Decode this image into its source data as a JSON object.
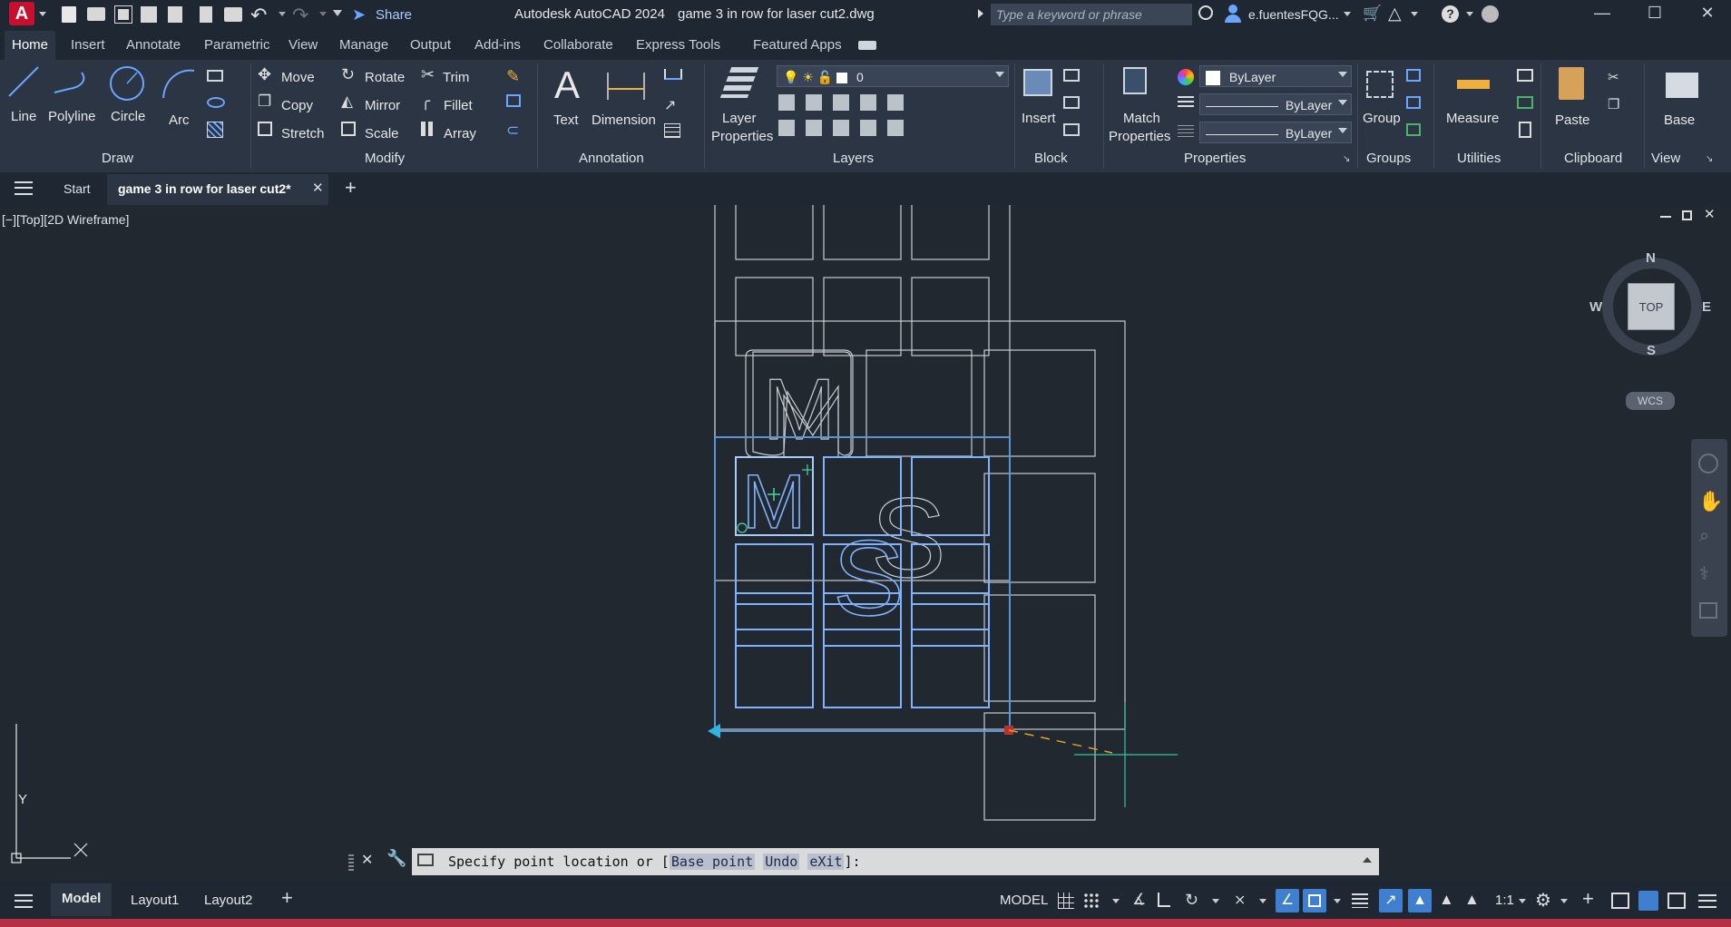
{
  "titlebar": {
    "app_title": "Autodesk AutoCAD 2024",
    "file_name": "game 3 in row for laser cut2.dwg",
    "share_label": "Share",
    "search_placeholder": "Type a keyword or phrase",
    "user_name": "e.fuentesFQG..."
  },
  "ribbon_tabs": [
    "Home",
    "Insert",
    "Annotate",
    "Parametric",
    "View",
    "Manage",
    "Output",
    "Add-ins",
    "Collaborate",
    "Express Tools",
    "Featured Apps"
  ],
  "draw": {
    "title": "Draw",
    "line": "Line",
    "polyline": "Polyline",
    "circle": "Circle",
    "arc": "Arc"
  },
  "modify": {
    "title": "Modify",
    "move": "Move",
    "rotate": "Rotate",
    "trim": "Trim",
    "copy": "Copy",
    "mirror": "Mirror",
    "fillet": "Fillet",
    "stretch": "Stretch",
    "scale": "Scale",
    "array": "Array"
  },
  "annotation": {
    "title": "Annotation",
    "text": "Text",
    "dimension": "Dimension"
  },
  "layers": {
    "title": "Layers",
    "layer_properties_1": "Layer",
    "layer_properties_2": "Properties",
    "current_layer": "0"
  },
  "block": {
    "title": "Block",
    "insert": "Insert"
  },
  "properties": {
    "title": "Properties",
    "match_1": "Match",
    "match_2": "Properties",
    "color": "ByLayer",
    "linetype": "ByLayer",
    "lineweight": "ByLayer"
  },
  "groups": {
    "title": "Groups",
    "group": "Group"
  },
  "utilities": {
    "title": "Utilities",
    "measure": "Measure"
  },
  "clipboard": {
    "title": "Clipboard",
    "paste": "Paste"
  },
  "view": {
    "title": "View",
    "base": "Base"
  },
  "doctabs": {
    "start": "Start",
    "active": "game 3 in row for laser cut2*"
  },
  "viewport": {
    "label": "[−][Top][2D Wireframe]",
    "compass": {
      "n": "N",
      "s": "S",
      "e": "E",
      "w": "W",
      "top": "TOP",
      "wcs": "WCS"
    },
    "ucs_y": "Y",
    "ucs_x": "X",
    "letters": {
      "m": "M",
      "s": "S"
    }
  },
  "command": {
    "prompt_start": "Specify point location or [",
    "opt_base": "Base point",
    "opt_undo": "Undo",
    "opt_exit": "eXit",
    "prompt_end": "]:"
  },
  "status": {
    "model_tab": "Model",
    "layout1": "Layout1",
    "layout2": "Layout2",
    "model_space": "MODEL",
    "scale": "1:1"
  },
  "colors": {
    "accent_blue": "#5a93d8",
    "selection": "#7fb2ff",
    "brand_red": "#c8102e"
  }
}
